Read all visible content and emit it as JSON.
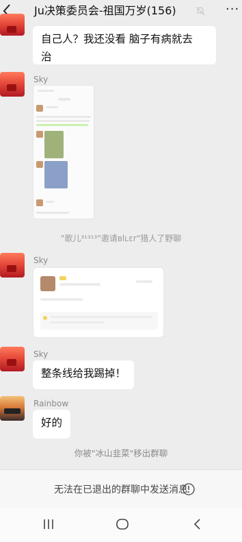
{
  "header": {
    "title": "Ju决策委员会-祖国万岁(156)",
    "mute_icon": "bell-muted-icon",
    "more_label": "···"
  },
  "messages": [
    {
      "sender": "",
      "text": "自己人？我还没看 脑子有病就去治",
      "line1": "自己人？我还没看 脑子有病就去",
      "line2": "治"
    },
    {
      "sender": "Sky",
      "type": "image"
    },
    {
      "sender": "Sky",
      "type": "card"
    },
    {
      "sender": "Sky",
      "text": "整条线给我踢掉！"
    },
    {
      "sender": "Rainbow",
      "text": "好的"
    }
  ],
  "system": [
    "\"歌儿³¹³¹³\"邀请ʙlʟɛr\"猎人了野聊",
    "你被\"冰山韭菜\"移出群聊"
  ],
  "input_bar": {
    "text": "无法在已退出的群聊中发送消息",
    "icon": "info-circle-icon"
  },
  "nav": [
    "recent-apps-icon",
    "home-icon",
    "back-icon"
  ]
}
